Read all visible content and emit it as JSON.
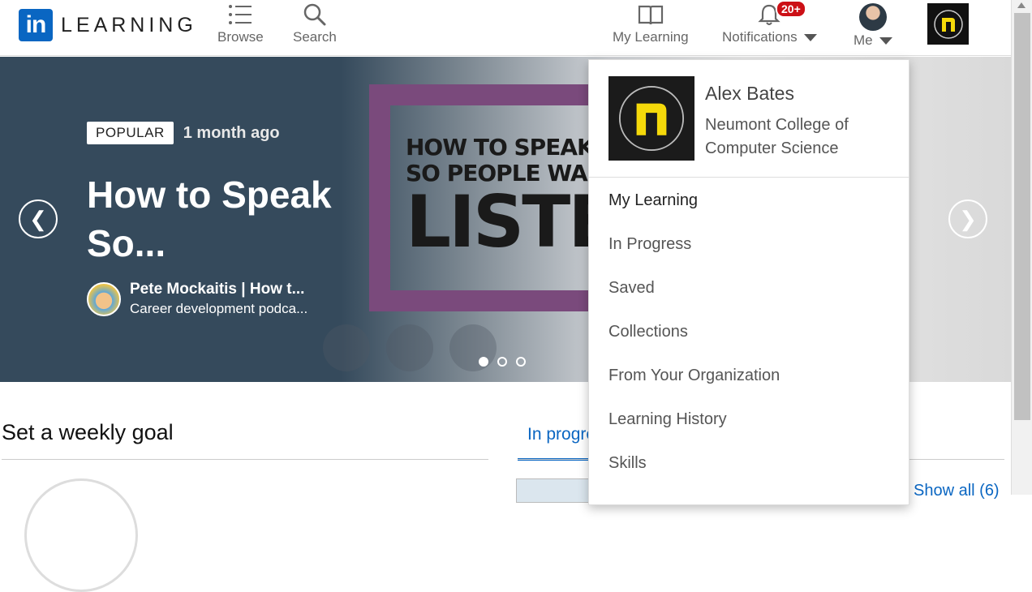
{
  "header": {
    "logo_box": "in",
    "logo_text": "LEARNING",
    "nav": {
      "browse": "Browse",
      "search": "Search",
      "my_learning": "My Learning",
      "notifications": "Notifications",
      "notification_count": "20+",
      "me": "Me"
    },
    "icons": {
      "browse": "list-icon",
      "search": "search-icon",
      "my_learning": "book-icon",
      "notifications": "bell-icon",
      "org": "neumont-logo"
    }
  },
  "hero": {
    "tag": "POPULAR",
    "age": "1 month ago",
    "title": "How to Speak So...",
    "author_name": "Pete Mockaitis | How t...",
    "author_subtitle": "Career development podca...",
    "image_lines": [
      "HOW TO SPEAK",
      "SO PEOPLE WA",
      "LISTE"
    ],
    "prev_arrow": "❮",
    "next_arrow": "❯",
    "slide_count": 3,
    "active_slide": 1
  },
  "main": {
    "goal_title": "Set a weekly goal",
    "tab_in_progress": "In progress",
    "show_all": "Show all (6)"
  },
  "dropdown": {
    "name": "Alex Bates",
    "organization": "Neumont College of Computer Science",
    "items": [
      "My Learning",
      "In Progress",
      "Saved",
      "Collections",
      "From Your Organization",
      "Learning History",
      "Skills"
    ]
  },
  "colors": {
    "brand": "#0a66c2",
    "hero_bg": "#354a5c",
    "badge": "#cc1016",
    "org_yellow": "#f5d90a"
  }
}
